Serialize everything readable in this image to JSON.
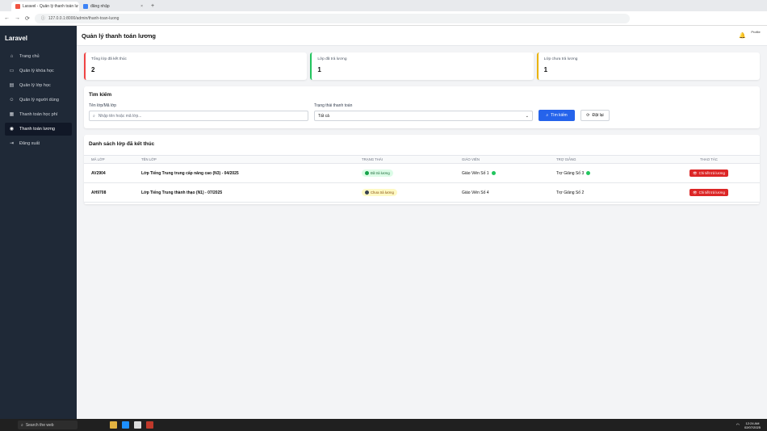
{
  "browser": {
    "tabs": [
      {
        "label": "Laravel - Quản lý thanh toán lư",
        "close": "×"
      },
      {
        "label": "đăng nhập",
        "close": "×"
      }
    ],
    "new_tab": "+",
    "url": "127.0.0.1:8000/admin/thanh-toan-luong",
    "nav": {
      "back": "←",
      "forward": "→",
      "reload": "⟳"
    }
  },
  "sidebar": {
    "brand": "Laravel",
    "items": [
      {
        "icon": "⌂",
        "label": "Trang chủ"
      },
      {
        "icon": "▭",
        "label": "Quản lý khóa học"
      },
      {
        "icon": "▤",
        "label": "Quản lý lớp học"
      },
      {
        "icon": "☺",
        "label": "Quản lý người dùng"
      },
      {
        "icon": "▦",
        "label": "Thanh toán học phí"
      },
      {
        "icon": "◉",
        "label": "Thanh toán lương"
      },
      {
        "icon": "⇥",
        "label": "Đăng xuất"
      }
    ]
  },
  "header": {
    "title": "Quản lý thanh toán lương",
    "avatar_text": "Profile"
  },
  "stats": [
    {
      "label": "Tổng lớp đã kết thúc",
      "value": "2",
      "color": "#ef4444"
    },
    {
      "label": "Lớp đã trả lương",
      "value": "1",
      "color": "#22c55e"
    },
    {
      "label": "Lớp chưa trả lương",
      "value": "1",
      "color": "#eab308"
    }
  ],
  "search": {
    "title": "Tìm kiếm",
    "keyword_label": "Tên lớp/Mã lớp",
    "keyword_placeholder": "Nhập tên hoặc mã lớp...",
    "status_label": "Trạng thái thanh toán",
    "status_value": "Tất cả",
    "search_button": "Tìm kiếm",
    "reset_button": "Đặt lại"
  },
  "list": {
    "title": "Danh sách lớp đã kết thúc",
    "columns": [
      "Mã lớp",
      "Tên lớp",
      "Trạng thái",
      "Giáo viên",
      "Trợ giảng",
      "Thao tác"
    ],
    "rows": [
      {
        "code": "AV2904",
        "name": "Lớp Tiếng Trung trung cấp nâng cao (N3) - 04/2025",
        "status": "Đã trả lương",
        "status_type": "paid",
        "teacher": "Giáo Viên Số 1",
        "teacher_check": true,
        "assistant": "Trợ Giảng Số 3",
        "assistant_check": true,
        "action": "Chi tiết trả lương"
      },
      {
        "code": "AH9708",
        "name": "Lớp Tiếng Trung thành thạo (N1) - 07/2025",
        "status": "Chưa trả lương",
        "status_type": "unpaid",
        "teacher": "Giáo Viên Số 4",
        "teacher_check": false,
        "assistant": "Trợ Giảng Số 2",
        "assistant_check": false,
        "action": "Chi tiết trả lương"
      }
    ]
  },
  "taskbar": {
    "search_placeholder": "Search the web",
    "time": "12:24 AM",
    "date": "02/07/2025"
  }
}
